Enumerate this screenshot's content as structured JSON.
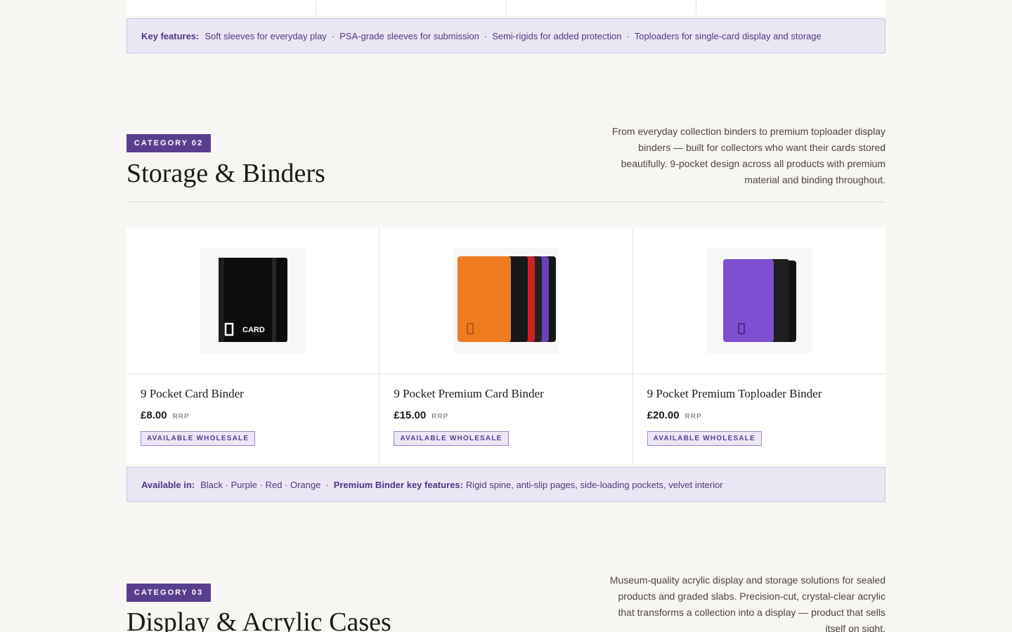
{
  "top_feature_bar": {
    "label": "Key features:",
    "items": [
      "Soft sleeves for everyday play",
      "PSA-grade sleeves for submission",
      "Semi-rigids for added protection",
      "Toploaders for single-card display and storage"
    ]
  },
  "category_02": {
    "badge": "CATEGORY 02",
    "title": "Storage & Binders",
    "description": "From everyday collection binders to premium toploader display binders — built for collectors who want their cards stored beautifully. 9-pocket design across all products with premium material and binding throughout."
  },
  "products": [
    {
      "name": "9 Pocket Card Binder",
      "price": "£8.00",
      "rrp": "RRP",
      "badge": "AVAILABLE WHOLESALE",
      "image": "black-binder",
      "logo_text": "CARD"
    },
    {
      "name": "9 Pocket Premium Card Binder",
      "price": "£15.00",
      "rrp": "RRP",
      "badge": "AVAILABLE WHOLESALE",
      "image": "multicolor-binders"
    },
    {
      "name": "9 Pocket Premium Toploader Binder",
      "price": "£20.00",
      "rrp": "RRP",
      "badge": "AVAILABLE WHOLESALE",
      "image": "purple-binder"
    }
  ],
  "binder_bar": {
    "available_label": "Available in:",
    "colors": "Black · Purple · Red · Orange",
    "features_label": "Premium Binder key features:",
    "features": "Rigid spine, anti-slip pages, side-loading pockets, velvet interior"
  },
  "category_03": {
    "badge": "CATEGORY 03",
    "title": "Display & Acrylic Cases",
    "description": "Museum-quality acrylic display and storage solutions for sealed products and graded slabs. Precision-cut, crystal-clear acrylic that transforms a collection into a display — product that sells itself on sight."
  },
  "colors": {
    "accent": "#5a3e8e",
    "feature_bg": "#ebe6f4",
    "page_bg": "#f8f6f2"
  }
}
